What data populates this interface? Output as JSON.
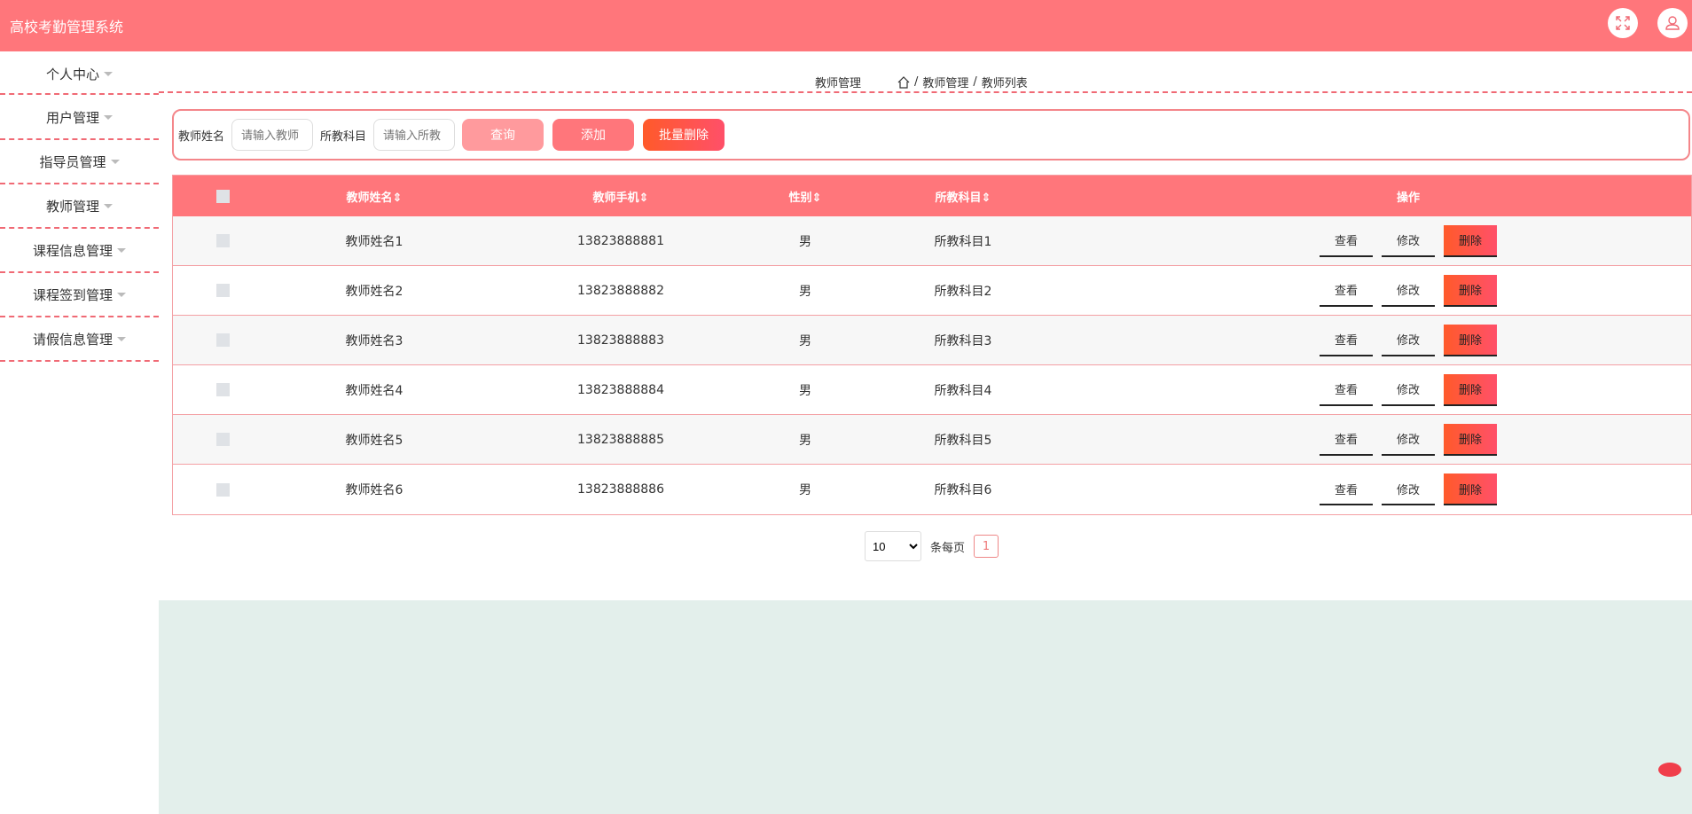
{
  "app": {
    "title": "高校考勤管理系统"
  },
  "sidebar": {
    "items": [
      {
        "label": "个人中心"
      },
      {
        "label": "用户管理"
      },
      {
        "label": "指导员管理"
      },
      {
        "label": "教师管理"
      },
      {
        "label": "课程信息管理"
      },
      {
        "label": "课程签到管理"
      },
      {
        "label": "请假信息管理"
      }
    ]
  },
  "breadcrumb": {
    "title": "教师管理",
    "path": [
      "教师管理",
      "教师列表"
    ],
    "sep": "/"
  },
  "search": {
    "name_label": "教师姓名",
    "name_placeholder": "请输入教师",
    "subject_label": "所教科目",
    "subject_placeholder": "请输入所教",
    "query": "查询",
    "add": "添加",
    "batch_delete": "批量删除"
  },
  "table": {
    "headers": [
      "教师姓名⇕",
      "教师手机⇕",
      "性别⇕",
      "所教科目⇕",
      "操作"
    ],
    "rows": [
      {
        "name": "教师姓名1",
        "phone": "13823888881",
        "sex": "男",
        "subject": "所教科目1"
      },
      {
        "name": "教师姓名2",
        "phone": "13823888882",
        "sex": "男",
        "subject": "所教科目2"
      },
      {
        "name": "教师姓名3",
        "phone": "13823888883",
        "sex": "男",
        "subject": "所教科目3"
      },
      {
        "name": "教师姓名4",
        "phone": "13823888884",
        "sex": "男",
        "subject": "所教科目4"
      },
      {
        "name": "教师姓名5",
        "phone": "13823888885",
        "sex": "男",
        "subject": "所教科目5"
      },
      {
        "name": "教师姓名6",
        "phone": "13823888886",
        "sex": "男",
        "subject": "所教科目6"
      }
    ],
    "actions": {
      "view": "查看",
      "edit": "修改",
      "delete": "删除"
    }
  },
  "pagination": {
    "page_size": "10",
    "per_page_label": "条每页",
    "current_page": "1"
  },
  "colors": {
    "primary": "#ff767b",
    "accent": "#ff5a2a"
  }
}
